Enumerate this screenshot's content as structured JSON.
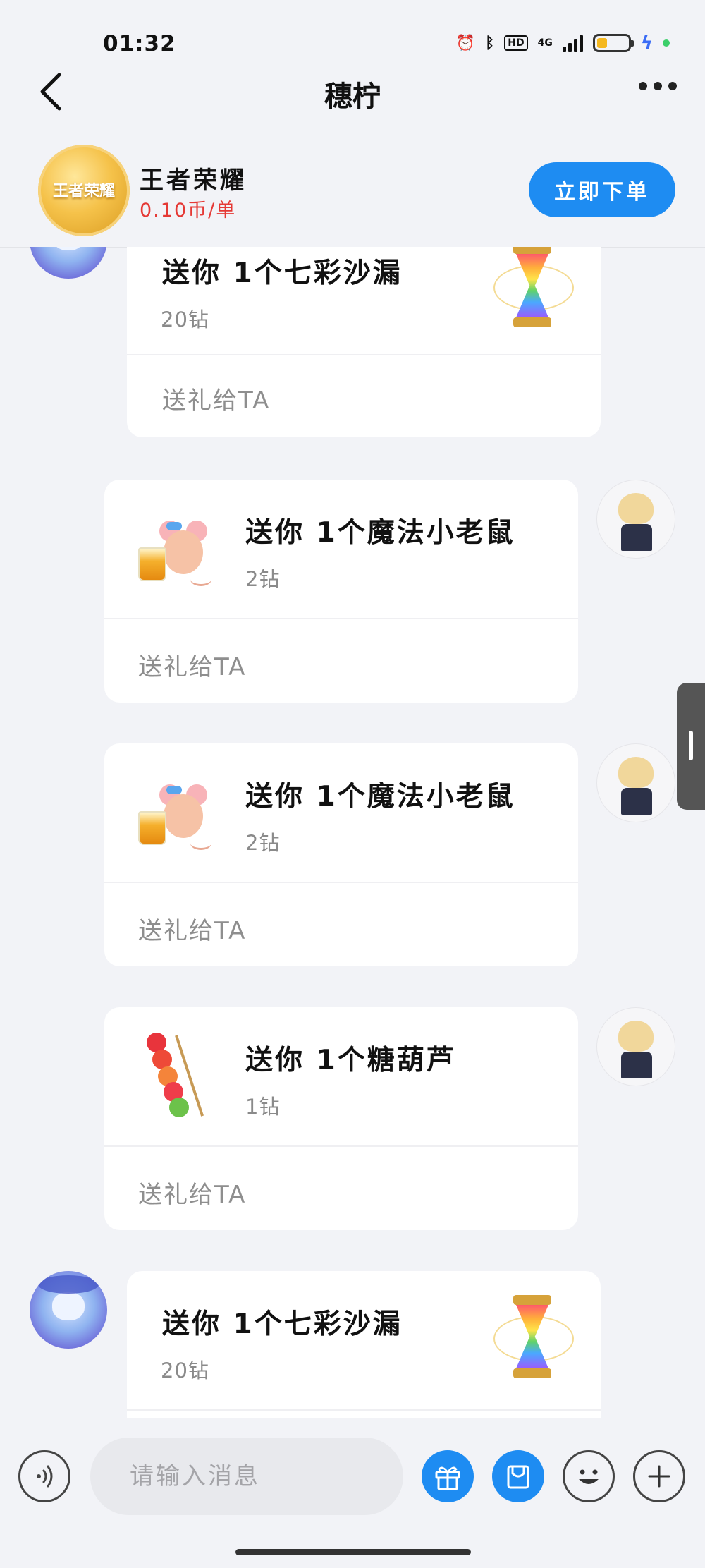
{
  "status_bar": {
    "time": "01:32",
    "hd": "HD",
    "network": "4G",
    "battery_level": 0.3,
    "battery_color": "#f5b820"
  },
  "nav": {
    "title": "穗柠"
  },
  "product": {
    "logo_text": "王者荣耀",
    "name": "王者荣耀",
    "price": "0.10币/单",
    "order_label": "立即下单"
  },
  "messages": [
    {
      "side": "left",
      "title": "送你 1个七彩沙漏",
      "cost": "20钻",
      "action": "送礼给TA",
      "gift_icon": "hourglass-icon"
    },
    {
      "side": "right",
      "title": "送你 1个魔法小老鼠",
      "cost": "2钻",
      "action": "送礼给TA",
      "gift_icon": "magic-mouse-icon"
    },
    {
      "side": "right",
      "title": "送你 1个魔法小老鼠",
      "cost": "2钻",
      "action": "送礼给TA",
      "gift_icon": "magic-mouse-icon"
    },
    {
      "side": "right",
      "title": "送你 1个糖葫芦",
      "cost": "1钻",
      "action": "送礼给TA",
      "gift_icon": "candied-haws-icon"
    },
    {
      "side": "left",
      "title": "送你 1个七彩沙漏",
      "cost": "20钻",
      "action": "",
      "gift_icon": "hourglass-icon"
    }
  ],
  "input": {
    "placeholder": "请输入消息"
  },
  "colors": {
    "accent": "#1e8cf2",
    "price_red": "#e53935",
    "background": "#f2f3f7"
  }
}
